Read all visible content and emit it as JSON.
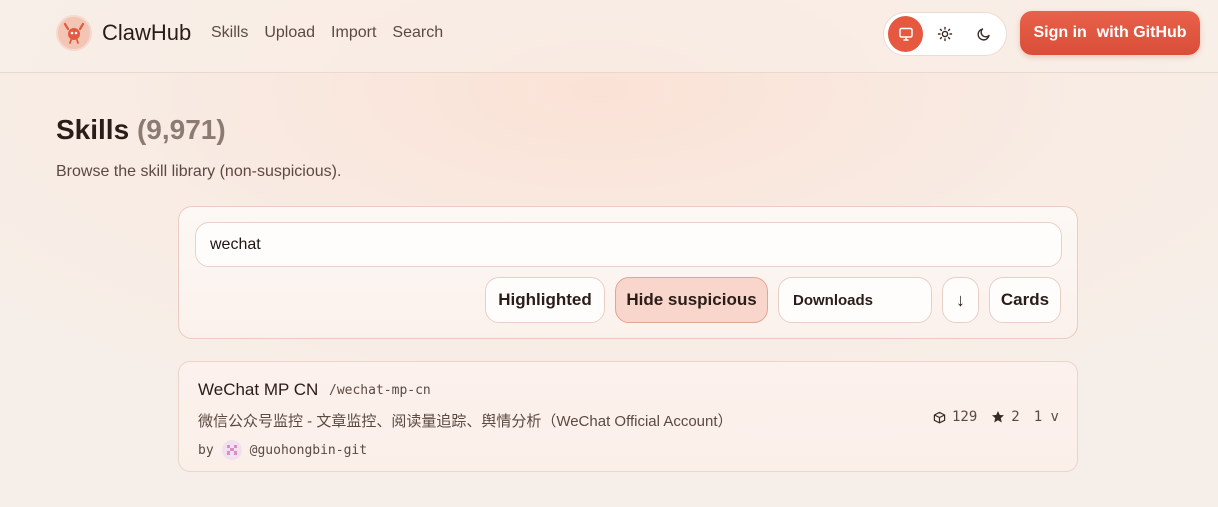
{
  "app": {
    "name": "ClawHub"
  },
  "nav": {
    "items": [
      "Skills",
      "Upload",
      "Import",
      "Search"
    ]
  },
  "theme": {
    "options": [
      "system",
      "light",
      "dark"
    ],
    "selected": "system"
  },
  "auth": {
    "signin_label": "Sign in",
    "signin_suffix": "with GitHub"
  },
  "page": {
    "title": "Skills",
    "count": "(9,971)",
    "subtitle": "Browse the skill library (non-suspicious)."
  },
  "search": {
    "value": "wechat"
  },
  "filters": {
    "highlighted_label": "Highlighted",
    "hide_suspicious_label": "Hide suspicious",
    "sort_label": "Downloads",
    "sort_direction": "↓",
    "view_label": "Cards"
  },
  "results": [
    {
      "name": "WeChat MP CN",
      "slug": "/wechat-mp-cn",
      "description": "微信公众号监控 - 文章监控、阅读量追踪、舆情分析（WeChat Official Account）",
      "by_label": "by",
      "author": "@guohongbin-git",
      "downloads": "129",
      "stars": "2",
      "versions": "1 v"
    }
  ],
  "colors": {
    "accent": "#e4593f",
    "accent_light": "#f8d6cb",
    "background": "#f7efe9"
  }
}
